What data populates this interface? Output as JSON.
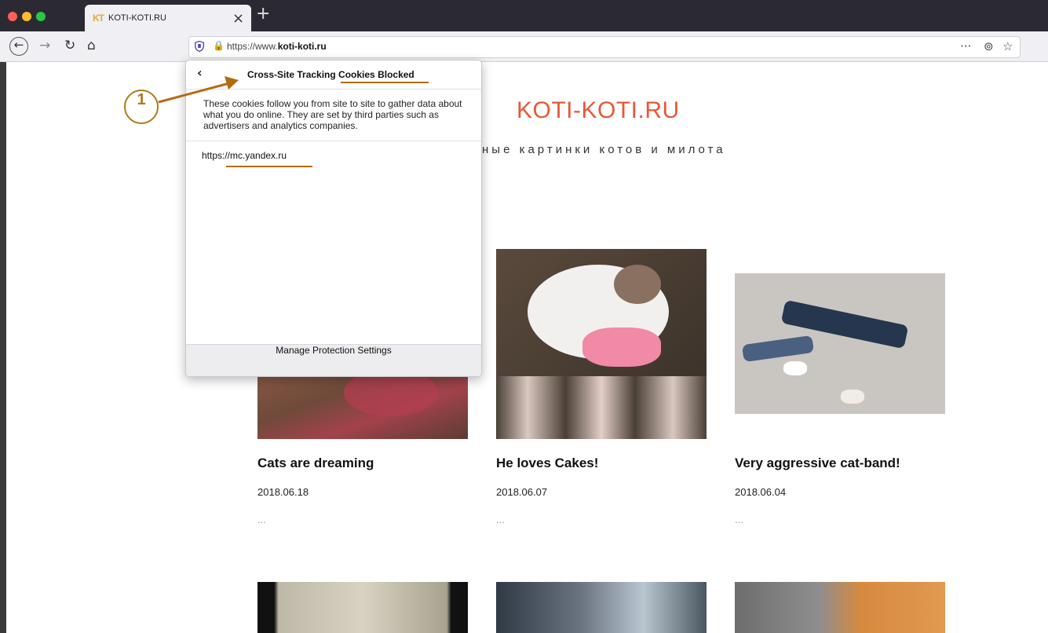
{
  "browser": {
    "tab_title": "KOTI-KOTI.RU",
    "tab_logo": "KT",
    "tab_close": "×",
    "new_tab": "+",
    "url_prefix": "https://www.",
    "url_domain": "koti-koti.ru",
    "icons": {
      "back": "back-arrow-icon",
      "forward": "forward-arrow-icon",
      "reload": "reload-icon",
      "home": "home-icon",
      "shield": "tracking-protection-shield-icon",
      "lock": "lock-icon",
      "more": "more-actions-icon",
      "pocket": "pocket-icon",
      "bookmark": "bookmark-star-icon"
    }
  },
  "page": {
    "site_title": "KOTI-KOTI.RU",
    "site_subtitle": "ные картинки котов и милота",
    "posts": [
      {
        "title": "Cats are dreaming",
        "date": "2018.06.18",
        "more": "..."
      },
      {
        "title": "He loves Cakes!",
        "date": "2018.06.07",
        "more": "..."
      },
      {
        "title": "Very aggressive cat-band!",
        "date": "2018.06.04",
        "more": "..."
      }
    ]
  },
  "popup": {
    "back": "‹",
    "title_prefix": "Cross-Site Tracking ",
    "title_suffix": "Cookies Blocked",
    "description": "These cookies follow you from site to site to gather data about what you do online. They are set by third parties such as advertisers and analytics companies.",
    "blocked_site": "https://mc.yandex.ru",
    "footer_button": "Manage Protection Settings"
  },
  "annotation": {
    "callout_number": "1"
  },
  "colors": {
    "accent_title": "#e35a37",
    "annotation": "#b07a1c",
    "tab_strip": "#2b2a33"
  }
}
